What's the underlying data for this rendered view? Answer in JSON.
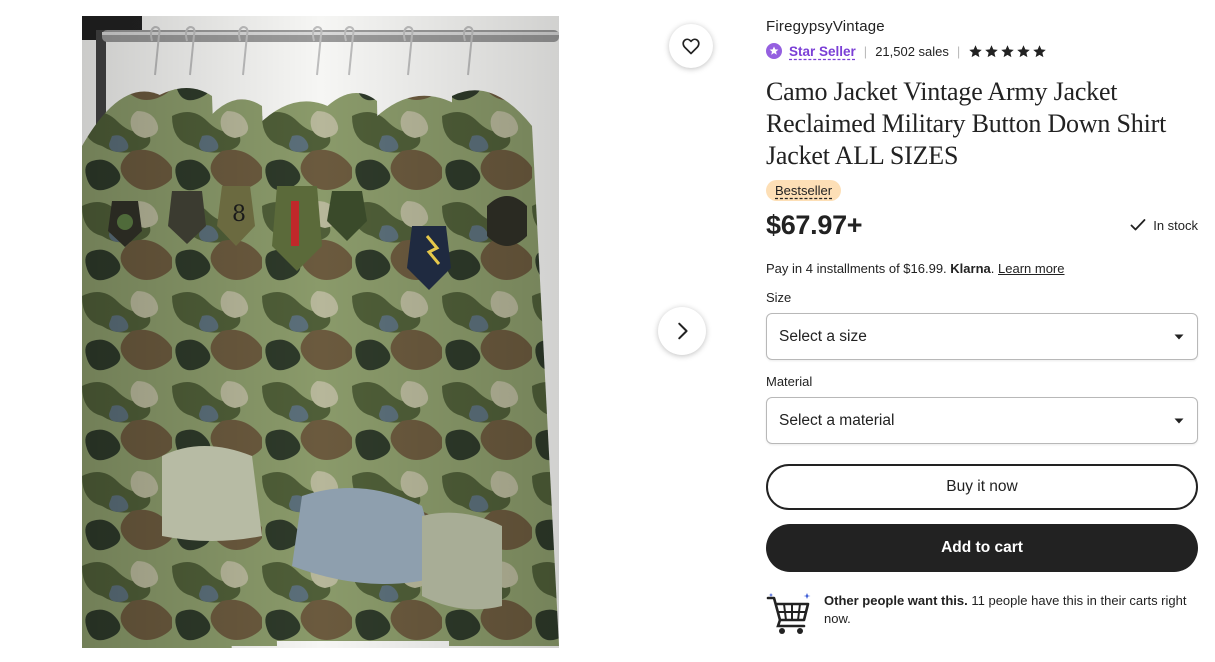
{
  "gallery": {
    "favorite_icon": "heart-icon",
    "next_icon": "chevron-right-icon"
  },
  "shop": {
    "name": "FiregypsyVintage",
    "star_seller_label": "Star Seller",
    "sales": "21,502 sales",
    "rating_stars": 5,
    "star_seller_color": "#7b3fd6"
  },
  "listing": {
    "title": "Camo Jacket Vintage Army Jacket Reclaimed Military Button Down Shirt Jacket ALL SIZES",
    "badge": "Bestseller",
    "price": "$67.97+",
    "stock": "In stock",
    "klarna_prefix": "Pay in 4 installments of $16.99.",
    "klarna_brand": "Klarna",
    "klarna_suffix": ".",
    "klarna_link": "Learn more"
  },
  "options": {
    "size_label": "Size",
    "size_value": "Select a size",
    "material_label": "Material",
    "material_value": "Select a material"
  },
  "actions": {
    "buy_now": "Buy it now",
    "add_to_cart": "Add to cart"
  },
  "demand": {
    "strong": "Other people want this.",
    "text": " 11 people have this in their carts right now."
  }
}
